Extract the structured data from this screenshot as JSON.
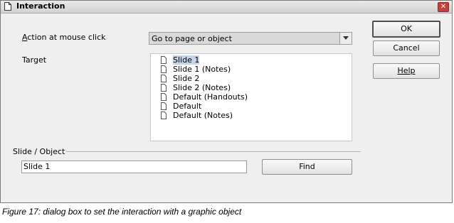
{
  "window": {
    "title": "Interaction",
    "close_glyph": "✕"
  },
  "form": {
    "action_label": "Action at mouse click",
    "action_value": "Go to page or object",
    "target_label": "Target",
    "targets": [
      {
        "label": "Slide 1",
        "selected": true,
        "icon": "document-icon"
      },
      {
        "label": "Slide 1 (Notes)",
        "selected": false,
        "icon": "document-icon"
      },
      {
        "label": "Slide 2",
        "selected": false,
        "icon": "document-icon"
      },
      {
        "label": "Slide 2 (Notes)",
        "selected": false,
        "icon": "document-icon"
      },
      {
        "label": "Default (Handouts)",
        "selected": false,
        "icon": "document-icon"
      },
      {
        "label": "Default",
        "selected": false,
        "icon": "document-icon"
      },
      {
        "label": "Default (Notes)",
        "selected": false,
        "icon": "document-icon"
      }
    ],
    "section_label": "Slide / Object",
    "slide_value": "Slide 1",
    "find_label": "Find"
  },
  "buttons": {
    "ok": "OK",
    "cancel": "Cancel",
    "help": "Help"
  },
  "caption": "Figure 17: dialog box to set the interaction with a graphic object"
}
